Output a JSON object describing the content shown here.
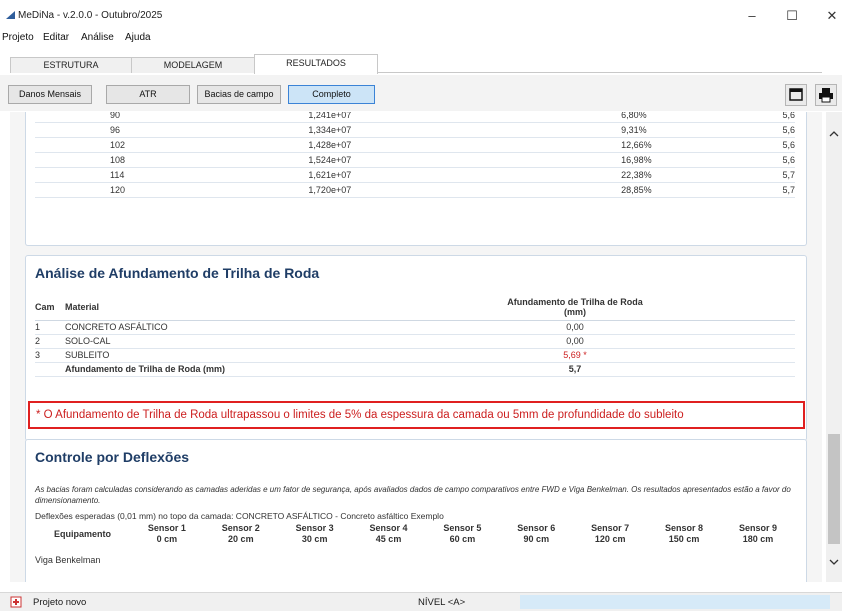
{
  "window": {
    "title": "MeDiNa - v.2.0.0 - Outubro/2025",
    "controls": {
      "minimize": "–",
      "maximize": "☐",
      "close": "✕"
    }
  },
  "menu": [
    "Projeto",
    "Editar",
    "Análise",
    "Ajuda"
  ],
  "tabs": [
    "ESTRUTURA",
    "MODELAGEM",
    "RESULTADOS"
  ],
  "active_tab": "RESULTADOS",
  "toolbar": {
    "buttons": [
      "Danos Mensais",
      "ATR",
      "Bacias de campo",
      "Completo"
    ],
    "selected": "Completo",
    "icons": [
      "window-icon",
      "printer-icon"
    ]
  },
  "months_table": [
    {
      "mes": "90",
      "n": "1,241e+07",
      "pct": "6,80%",
      "atr": "5,6"
    },
    {
      "mes": "96",
      "n": "1,334e+07",
      "pct": "9,31%",
      "atr": "5,6"
    },
    {
      "mes": "102",
      "n": "1,428e+07",
      "pct": "12,66%",
      "atr": "5,6"
    },
    {
      "mes": "108",
      "n": "1,524e+07",
      "pct": "16,98%",
      "atr": "5,6"
    },
    {
      "mes": "114",
      "n": "1,621e+07",
      "pct": "22,38%",
      "atr": "5,7"
    },
    {
      "mes": "120",
      "n": "1,720e+07",
      "pct": "28,85%",
      "atr": "5,7"
    }
  ],
  "rutting": {
    "title": "Análise de Afundamento de Trilha de Roda",
    "col_cam": "Cam",
    "col_material": "Material",
    "col_value": "Afundamento de Trilha de Roda",
    "col_value_unit": "(mm)",
    "rows": [
      {
        "cam": "1",
        "material": "CONCRETO ASFÁLTICO",
        "value": "0,00",
        "warn": false
      },
      {
        "cam": "2",
        "material": "SOLO-CAL",
        "value": "0,00",
        "warn": false
      },
      {
        "cam": "3",
        "material": "SUBLEITO",
        "value": "5,69 *",
        "warn": true
      }
    ],
    "total_label": "Afundamento de Trilha de Roda (mm)",
    "total_value": "5,7",
    "warning_note": "* O Afundamento de Trilha de Roda ultrapassou o limites de 5% da espessura da camada ou 5mm de profundidade do subleito",
    "warn_color": "#cc1f1f"
  },
  "deflections": {
    "title": "Controle por Deflexões",
    "description": "As bacias foram calculadas considerando as camadas aderidas e um fator de segurança, após avaliados dados de campo comparativos entre FWD e Viga Benkelman. Os resultados apresentados estão a favor do dimensionamento.",
    "expected_label": "Deflexões esperadas (0,01 mm) no topo da camada: CONCRETO ASFÁLTICO - Concreto asfáltico Exemplo",
    "equip_header": "Equipamento",
    "sensors": [
      {
        "name": "Sensor 1",
        "dist": "0 cm"
      },
      {
        "name": "Sensor 2",
        "dist": "20 cm"
      },
      {
        "name": "Sensor 3",
        "dist": "30 cm"
      },
      {
        "name": "Sensor 4",
        "dist": "45 cm"
      },
      {
        "name": "Sensor 5",
        "dist": "60 cm"
      },
      {
        "name": "Sensor 6",
        "dist": "90 cm"
      },
      {
        "name": "Sensor 7",
        "dist": "120 cm"
      },
      {
        "name": "Sensor 8",
        "dist": "150 cm"
      },
      {
        "name": "Sensor 9",
        "dist": "180 cm"
      }
    ],
    "first_row": "Viga Benkelman"
  },
  "statusbar": {
    "project": "Projeto novo",
    "level": "NÍVEL <A>"
  },
  "colors": {
    "heading": "#1f3d66",
    "accent": "#3b83d6",
    "warning": "#e02020"
  }
}
